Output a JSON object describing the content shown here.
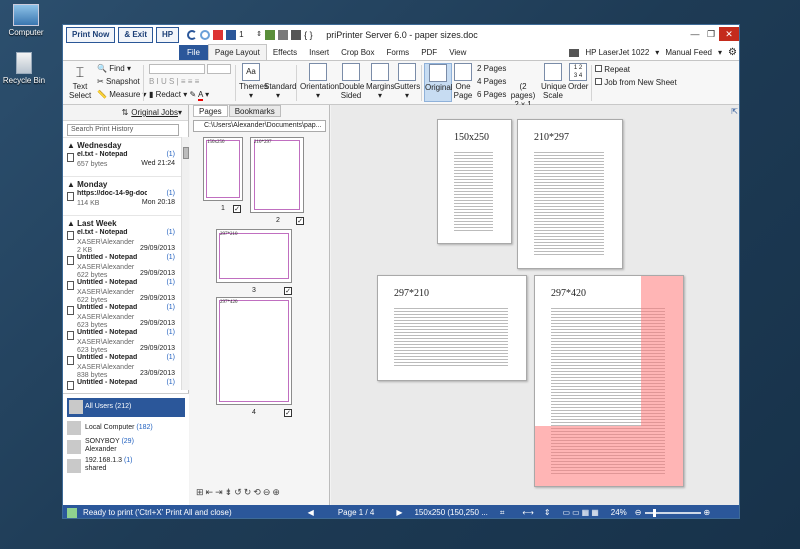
{
  "desktop": {
    "icons": [
      {
        "label": "Computer"
      },
      {
        "label": "Recycle Bin"
      }
    ]
  },
  "window": {
    "title": "priPrinter Server 6.0 - paper sizes.doc",
    "quick_buttons": [
      "Print Now",
      "& Exit",
      "HP"
    ],
    "page_field": "1",
    "file_tab": "File",
    "tabs": [
      "Page Layout",
      "Effects",
      "Insert",
      "Crop Box",
      "Forms",
      "PDF",
      "View"
    ],
    "active_tab": "Page Layout",
    "printer": "HP LaserJet 1022",
    "feed": "Manual Feed"
  },
  "ribbon": {
    "text_select": "Text\nSelect",
    "find": "Find",
    "snapshot": "Snapshot",
    "measure": "Measure",
    "redact": "Redact",
    "themes": "Themes",
    "standard": "Standard",
    "orientation": "Orientation",
    "double_sided": "Double\nSided",
    "margins": "Margins",
    "gutters": "Gutters",
    "original": "Original",
    "one_page": "One\nPage",
    "two_pages": "2 Pages",
    "four_pages": "4 Pages",
    "six_pages": "6 Pages",
    "two_pages_multi": "(2 pages)",
    "two_by_one": "2 x 1",
    "unique_scale": "Unique\nScale",
    "order": "Order",
    "repeat": "Repeat",
    "job_from_new_sheet": "Job from New Sheet"
  },
  "left_pane": {
    "original_jobs": "Original Jobs",
    "search_placeholder": "Search Print History",
    "groups": [
      {
        "name": "Wednesday",
        "items": [
          {
            "name": "el.txt - Notepad",
            "count": "(1)",
            "sub": "657 bytes",
            "date": "Wed 21:24"
          }
        ]
      },
      {
        "name": "Monday",
        "items": [
          {
            "name": "https://doc-14-9g-docs...",
            "count": "(1)",
            "sub": "114 KB",
            "date": "Mon 20:18"
          }
        ]
      },
      {
        "name": "Last Week",
        "items": [
          {
            "name": "el.txt - Notepad",
            "count": "(1)",
            "sub": "XASER\\Alexander",
            "sub2": "2 KB",
            "date": "29/09/2013"
          },
          {
            "name": "Untitled - Notepad",
            "count": "(1)",
            "sub": "XASER\\Alexander",
            "sub2": "622 bytes",
            "date": "29/09/2013"
          },
          {
            "name": "Untitled - Notepad",
            "count": "(1)",
            "sub": "XASER\\Alexander",
            "sub2": "622 bytes",
            "date": "29/09/2013"
          },
          {
            "name": "Untitled - Notepad",
            "count": "(1)",
            "sub": "XASER\\Alexander",
            "sub2": "623 bytes",
            "date": "29/09/2013"
          },
          {
            "name": "Untitled - Notepad",
            "count": "(1)",
            "sub": "XASER\\Alexander",
            "sub2": "623 bytes",
            "date": "29/09/2013"
          },
          {
            "name": "Untitled - Notepad",
            "count": "(1)",
            "sub": "XASER\\Alexander",
            "sub2": "838 bytes",
            "date": "23/09/2013"
          },
          {
            "name": "Untitled - Notepad",
            "count": "(1)",
            "sub": "",
            "sub2": "",
            "date": ""
          }
        ]
      }
    ],
    "users": [
      {
        "name": "All Users",
        "count": "(212)",
        "selected": true
      },
      {
        "name": "Local Computer",
        "count": "(182)"
      },
      {
        "name": "SONYBOY",
        "count": "(29)",
        "sub": "Alexander"
      },
      {
        "name": "192.168.1.3",
        "count": "(1)",
        "sub": "shared"
      }
    ]
  },
  "mid_pane": {
    "tabs": [
      "Pages",
      "Bookmarks"
    ],
    "path": "C:\\Users\\Alexander\\Documents\\pap...",
    "thumbs": [
      {
        "label": "1",
        "title": "150x250"
      },
      {
        "label": "2",
        "title": "210*297"
      },
      {
        "label": "3",
        "title": "297*210"
      },
      {
        "label": "4",
        "title": "297*420"
      }
    ]
  },
  "viewer": {
    "pages": [
      {
        "title": "150x250"
      },
      {
        "title": "210*297"
      },
      {
        "title": "297*210"
      },
      {
        "title": "297*420"
      }
    ]
  },
  "status": {
    "text": "Ready to print ('Ctrl+X' Print All and close)",
    "page": "Page 1 / 4",
    "size": "150x250 (150,250 ...",
    "zoom": "24%"
  }
}
